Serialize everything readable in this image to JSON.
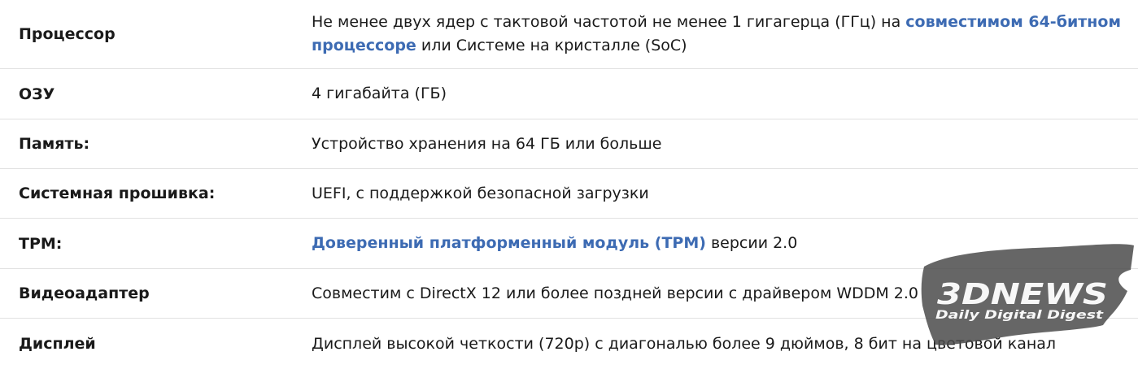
{
  "rows": [
    {
      "label": "Процессор",
      "value_before": "Не менее двух ядер с тактовой частотой не менее 1 гигагерца (ГГц) на ",
      "value_link": "совместимом 64-битном процессоре",
      "value_after": " или Системе на кристалле (SoC)"
    },
    {
      "label": "ОЗУ",
      "value": "4 гигабайта (ГБ)"
    },
    {
      "label": "Память:",
      "value": "Устройство хранения на 64 ГБ или больше"
    },
    {
      "label": "Системная прошивка:",
      "value": "UEFI, с поддержкой безопасной загрузки"
    },
    {
      "label": "TPM:",
      "value_link": "Доверенный платформенный модуль (TPM)",
      "value_after": " версии 2.0"
    },
    {
      "label": "Видеоадаптер",
      "value": "Совместим с DirectX 12 или более поздней версии с драйвером WDDM 2.0"
    },
    {
      "label": "Дисплей",
      "value": "Дисплей высокой четкости (720p) с диагональю более 9 дюймов, 8 бит на цветовой канал"
    }
  ],
  "watermark": {
    "logo": "3DNEWS",
    "tagline": "Daily Digital Digest"
  }
}
